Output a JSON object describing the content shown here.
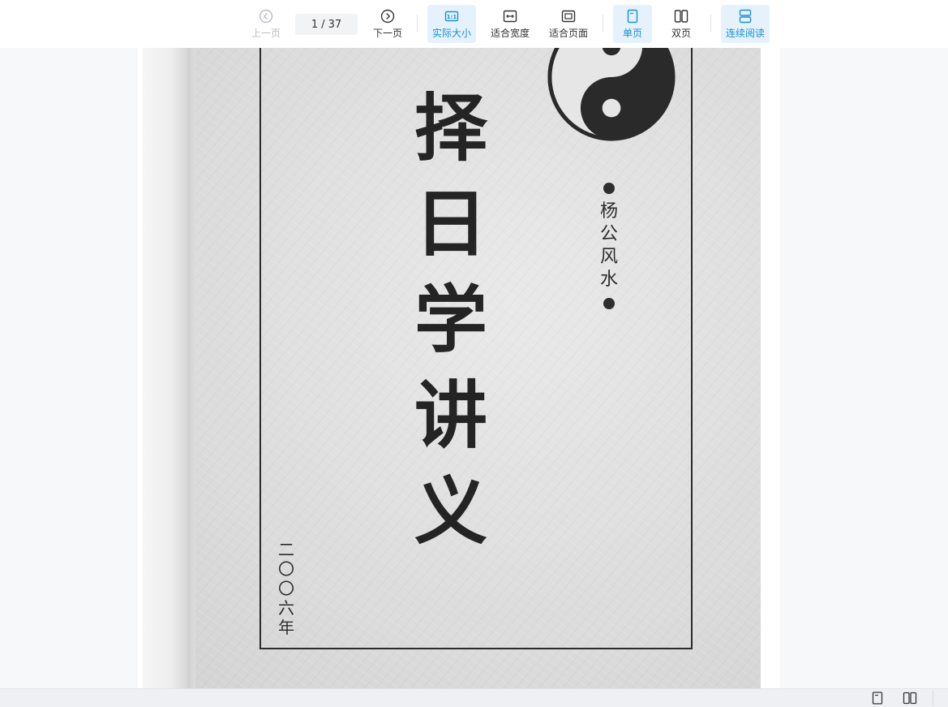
{
  "toolbar": {
    "prev": {
      "label": "上一页",
      "icon": "chevron-left-circle-icon",
      "enabled": false
    },
    "page_current": "1",
    "page_separator": "/",
    "page_total": "37",
    "next": {
      "label": "下一页",
      "icon": "chevron-right-circle-icon"
    },
    "actual_size": {
      "label": "实际大小",
      "icon": "one-to-one-icon",
      "active": true
    },
    "fit_width": {
      "label": "适合宽度",
      "icon": "fit-width-icon"
    },
    "fit_page": {
      "label": "适合页面",
      "icon": "fit-page-icon"
    },
    "single_page": {
      "label": "单页",
      "icon": "single-page-icon",
      "active": true
    },
    "double_page": {
      "label": "双页",
      "icon": "double-page-icon"
    },
    "continuous": {
      "label": "连续阅读",
      "icon": "continuous-scroll-icon",
      "active": true
    }
  },
  "document": {
    "title_chars": [
      "择",
      "日",
      "学",
      "讲",
      "义"
    ],
    "author_chars": [
      "杨",
      "公",
      "风",
      "水"
    ],
    "year_chars": [
      "二",
      "〇",
      "〇",
      "六",
      "年"
    ]
  },
  "statusbar": {
    "single_icon": "single-page-icon",
    "double_icon": "double-page-icon"
  },
  "colors": {
    "accent": "#1a8fd8",
    "active_bg": "#e5f2fb",
    "disabled": "#b9bcc2"
  }
}
